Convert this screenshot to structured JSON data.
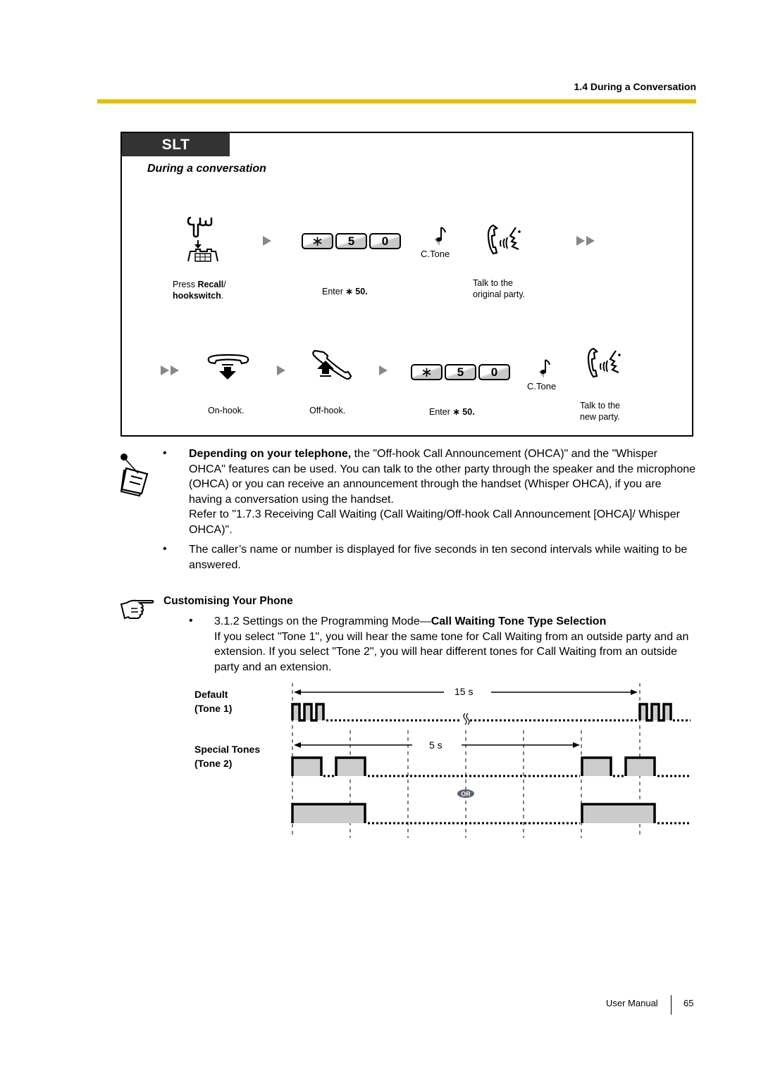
{
  "header": {
    "section": "1.4 During a Conversation",
    "accent_color": "#e2bf00"
  },
  "slt_box": {
    "tab_label": "SLT",
    "subtitle": "During a conversation",
    "row1": {
      "step1": {
        "label_bold1": "Recall",
        "label_pre": "Press ",
        "label_post": "/",
        "label_bold2": "hookswitch",
        "label_end": "."
      },
      "keys": [
        "∗",
        "5",
        "0"
      ],
      "step2": {
        "label_pre": "Enter ",
        "label_bold": "∗ 50."
      },
      "ctone": "C.Tone",
      "step3": {
        "label_line1": "Talk to the",
        "label_line2": "original party."
      }
    },
    "row2": {
      "step1": {
        "label": "On-hook."
      },
      "step2": {
        "label": "Off-hook."
      },
      "keys": [
        "∗",
        "5",
        "0"
      ],
      "step3": {
        "label_pre": "Enter ",
        "label_bold": "∗ 50."
      },
      "ctone": "C.Tone",
      "step4": {
        "label_line1": "Talk to the",
        "label_line2": "new party."
      }
    }
  },
  "notes": {
    "bullet": "•",
    "item1": {
      "bold": "Depending on your telephone,",
      "text": " the \"Off-hook Call Announcement (OHCA)\" and the \"Whisper OHCA\" features can be used. You can talk to the other party through the speaker and the microphone (OHCA) or you can receive an announcement through the handset (Whisper OHCA), if you are having a conversation using the handset.",
      "refer": "Refer to \"1.7.3 Receiving Call Waiting (Call Waiting/Off-hook Call Announcement [OHCA]/ Whisper OHCA)\"."
    },
    "item2": "The caller’s name or number is displayed for five seconds in ten second intervals while waiting to be answered."
  },
  "customising": {
    "title": "Customising Your Phone",
    "item_pre": "3.1.2 Settings on the Programming Mode—",
    "item_bold": "Call Waiting Tone Type Selection",
    "desc": "If you select \"Tone 1\", you will hear the same tone for Call Waiting from an outside party and an extension. If you select \"Tone 2\", you will hear different tones for Call Waiting from an outside party and an extension."
  },
  "tone_diagram": {
    "default_label_1": "Default",
    "default_label_2": "(Tone 1)",
    "special_label_1": "Special Tones",
    "special_label_2": "(Tone 2)",
    "interval_tone1": "15 s",
    "interval_tone2": "5 s",
    "or_label": "OR",
    "fill_color": "#cccccc"
  },
  "footer": {
    "label": "User Manual",
    "page": "65"
  }
}
